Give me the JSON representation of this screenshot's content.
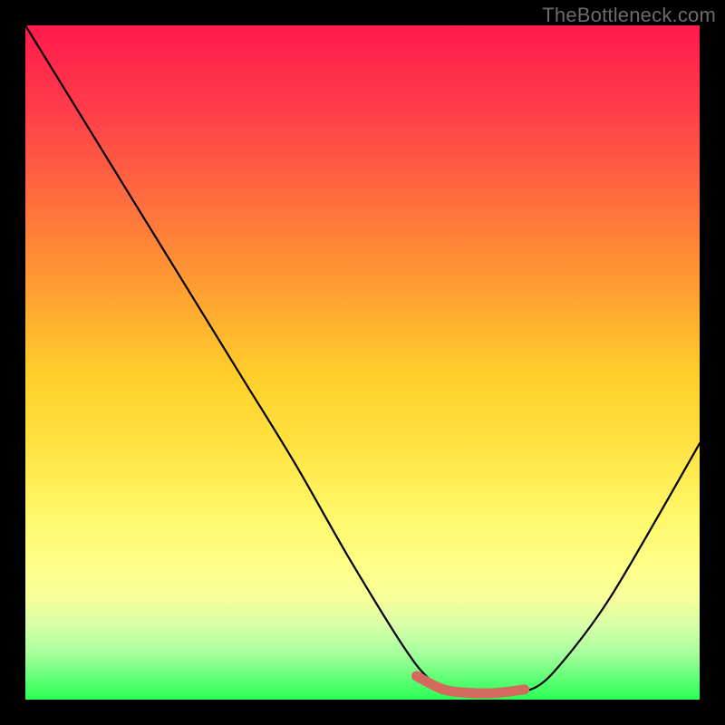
{
  "watermark": "TheBottleneck.com",
  "chart_data": {
    "type": "line",
    "title": "",
    "xlabel": "",
    "ylabel": "",
    "xlim": [
      0,
      100
    ],
    "ylim": [
      0,
      100
    ],
    "grid": false,
    "axes_visible": false,
    "legend": false,
    "background": "rainbow-vertical-gradient",
    "series": [
      {
        "name": "bottleneck-curve",
        "color": "#000000",
        "x": [
          0,
          8,
          16,
          24,
          32,
          40,
          48,
          56,
          60,
          64,
          68,
          72,
          76,
          80,
          86,
          92,
          100
        ],
        "y": [
          100,
          87,
          74,
          61,
          48,
          35,
          21,
          8,
          3,
          1,
          1,
          1,
          2,
          6,
          14,
          24,
          38
        ]
      }
    ],
    "highlight": {
      "name": "minimum-plateau",
      "color": "#d46a5e",
      "x": [
        58,
        62,
        66,
        70,
        74
      ],
      "y": [
        3.5,
        1.5,
        1,
        1,
        1.5
      ]
    },
    "notes": "Values are estimated from the rendered curve; no numeric axis ticks are shown in the source image."
  }
}
